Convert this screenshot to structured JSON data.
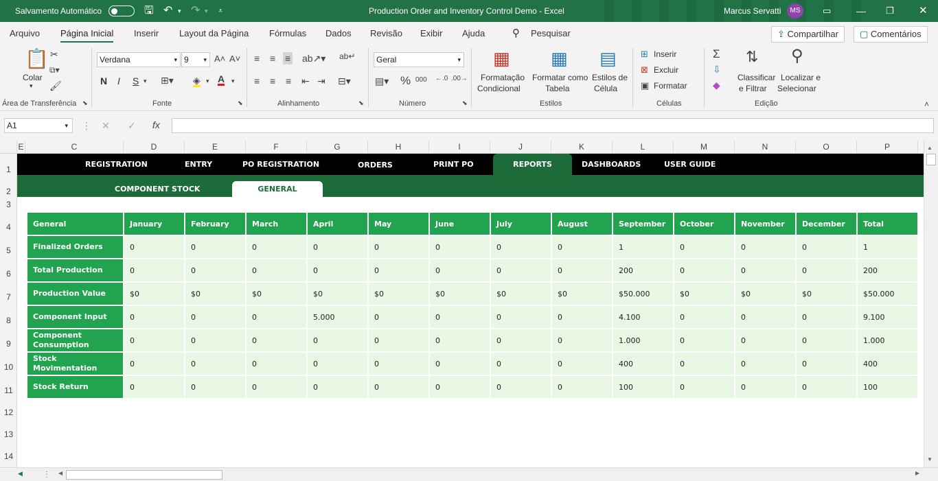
{
  "titlebar": {
    "autosave_label": "Salvamento Automático",
    "title": "Production Order and Inventory Control Demo  -  Excel",
    "user_name": "Marcus Servatti",
    "user_initials": "MS"
  },
  "ribbon_tabs": [
    "Arquivo",
    "Página Inicial",
    "Inserir",
    "Layout da Página",
    "Fórmulas",
    "Dados",
    "Revisão",
    "Exibir",
    "Ajuda"
  ],
  "search_label": "Pesquisar",
  "share_label": "Compartilhar",
  "comments_label": "Comentários",
  "ribbon": {
    "paste_label": "Colar",
    "clipboard_group": "Área de Transferência",
    "font_name": "Verdana",
    "font_size": "9",
    "font_group": "Fonte",
    "bold": "N",
    "italic": "I",
    "underline": "S",
    "alignment_group": "Alinhamento",
    "number_format": "Geral",
    "number_group": "Número",
    "conditional_format": [
      "Formatação",
      "Condicional"
    ],
    "format_table": [
      "Formatar como",
      "Tabela"
    ],
    "cell_styles": [
      "Estilos de",
      "Célula"
    ],
    "styles_group": "Estilos",
    "insert": "Inserir",
    "delete": "Excluir",
    "format": "Formatar",
    "cells_group": "Células",
    "sort_filter": [
      "Classificar",
      "e Filtrar"
    ],
    "find_select": [
      "Localizar e",
      "Selecionar"
    ],
    "editing_group": "Edição"
  },
  "formula_bar": {
    "name_box": "A1",
    "formula": ""
  },
  "columns": [
    "E",
    "C",
    "D",
    "E",
    "F",
    "G",
    "H",
    "I",
    "J",
    "K",
    "L",
    "M",
    "N",
    "O",
    "P"
  ],
  "rows": [
    "1",
    "2",
    "3",
    "4",
    "5",
    "6",
    "7",
    "8",
    "9",
    "10",
    "11",
    "12",
    "13",
    "14"
  ],
  "nav_tabs": [
    "REGISTRATION",
    "ENTRY",
    "PO REGISTRATION",
    "ORDERS",
    "PRINT PO",
    "REPORTS",
    "DASHBOARDS",
    "USER GUIDE"
  ],
  "sub_tabs": [
    "COMPONENT STOCK",
    "GENERAL"
  ],
  "table": {
    "header": [
      "General",
      "January",
      "February",
      "March",
      "April",
      "May",
      "June",
      "July",
      "August",
      "September",
      "October",
      "November",
      "December",
      "Total"
    ],
    "rows": [
      {
        "label": "Finalized Orders",
        "values": [
          "0",
          "0",
          "0",
          "0",
          "0",
          "0",
          "0",
          "0",
          "1",
          "0",
          "0",
          "0",
          "1"
        ]
      },
      {
        "label": "Total Production",
        "values": [
          "0",
          "0",
          "0",
          "0",
          "0",
          "0",
          "0",
          "0",
          "200",
          "0",
          "0",
          "0",
          "200"
        ]
      },
      {
        "label": "Production Value",
        "values": [
          "$0",
          "$0",
          "$0",
          "$0",
          "$0",
          "$0",
          "$0",
          "$0",
          "$50.000",
          "$0",
          "$0",
          "$0",
          "$50.000"
        ]
      },
      {
        "label": "Component Input",
        "values": [
          "0",
          "0",
          "0",
          "5.000",
          "0",
          "0",
          "0",
          "0",
          "4.100",
          "0",
          "0",
          "0",
          "9.100"
        ]
      },
      {
        "label": "Component Consumption",
        "values": [
          "0",
          "0",
          "0",
          "0",
          "0",
          "0",
          "0",
          "0",
          "1.000",
          "0",
          "0",
          "0",
          "1.000"
        ]
      },
      {
        "label": "Stock Movimentation",
        "values": [
          "0",
          "0",
          "0",
          "0",
          "0",
          "0",
          "0",
          "0",
          "400",
          "0",
          "0",
          "0",
          "400"
        ]
      },
      {
        "label": "Stock Return",
        "values": [
          "0",
          "0",
          "0",
          "0",
          "0",
          "0",
          "0",
          "0",
          "100",
          "0",
          "0",
          "0",
          "100"
        ]
      }
    ]
  },
  "colors": {
    "excel_green": "#217346",
    "nav_bg": "#000000",
    "active_tab": "#1e6b3a",
    "header_cell": "#21a350",
    "value_cell": "#e9f7e5"
  }
}
